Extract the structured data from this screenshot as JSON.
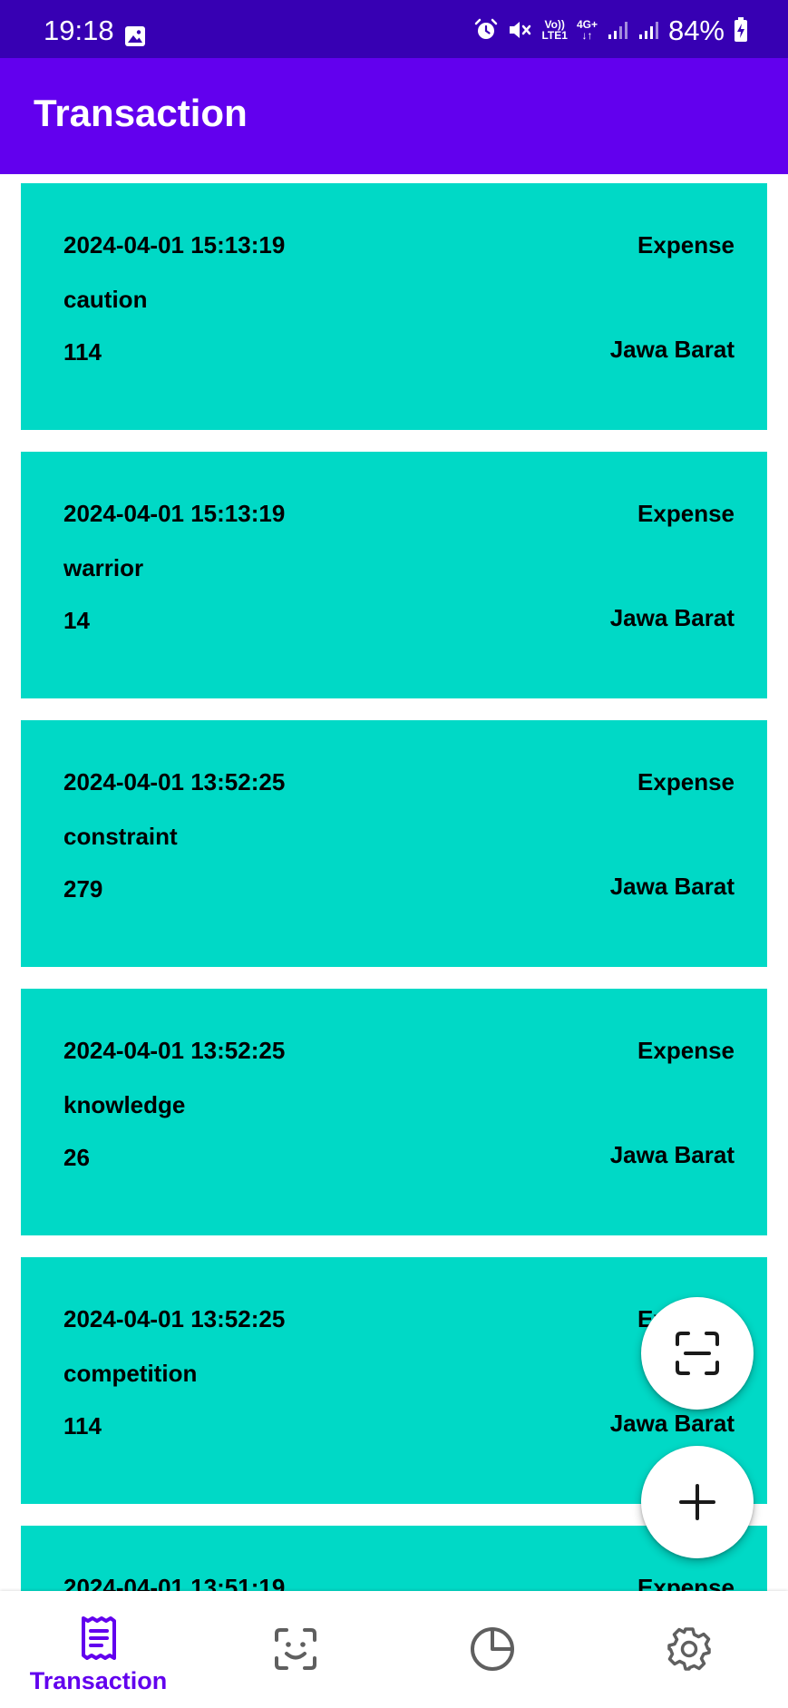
{
  "status_bar": {
    "time": "19:18",
    "network_top": "4G+",
    "volte_top": "Vo))",
    "volte_bottom": "LTE1",
    "battery": "84%",
    "icons": [
      "gallery-icon",
      "alarm-icon",
      "mute-icon",
      "volte-icon",
      "data-arrows-icon",
      "signal-icon",
      "signal-icon",
      "battery-charging-icon"
    ]
  },
  "app_bar": {
    "title": "Transaction"
  },
  "transactions": [
    {
      "datetime": "2024-04-01 15:13:19",
      "type": "Expense",
      "category": "caution",
      "amount": "114",
      "region": "Jawa Barat"
    },
    {
      "datetime": "2024-04-01 15:13:19",
      "type": "Expense",
      "category": "warrior",
      "amount": "14",
      "region": "Jawa Barat"
    },
    {
      "datetime": "2024-04-01 13:52:25",
      "type": "Expense",
      "category": "constraint",
      "amount": "279",
      "region": "Jawa Barat"
    },
    {
      "datetime": "2024-04-01 13:52:25",
      "type": "Expense",
      "category": "knowledge",
      "amount": "26",
      "region": "Jawa Barat"
    },
    {
      "datetime": "2024-04-01 13:52:25",
      "type": "Expense",
      "category": "competition",
      "amount": "114",
      "region": "Jawa Barat"
    },
    {
      "datetime": "2024-04-01 13:51:19",
      "type": "Expense",
      "category": "",
      "amount": "",
      "region": ""
    }
  ],
  "fabs": {
    "scan_icon": "scan-icon",
    "add_icon": "plus-icon"
  },
  "bottom_nav": {
    "items": [
      {
        "label": "Transaction",
        "icon": "receipt-icon",
        "active": true
      },
      {
        "label": "",
        "icon": "face-scan-icon",
        "active": false
      },
      {
        "label": "",
        "icon": "pie-chart-icon",
        "active": false
      },
      {
        "label": "",
        "icon": "gear-icon",
        "active": false
      }
    ]
  },
  "colors": {
    "status_bar": "#3700b3",
    "app_bar": "#6200ee",
    "card": "#00d9c6",
    "accent": "#6200ee",
    "inactive_icon": "#5f5f5f"
  }
}
